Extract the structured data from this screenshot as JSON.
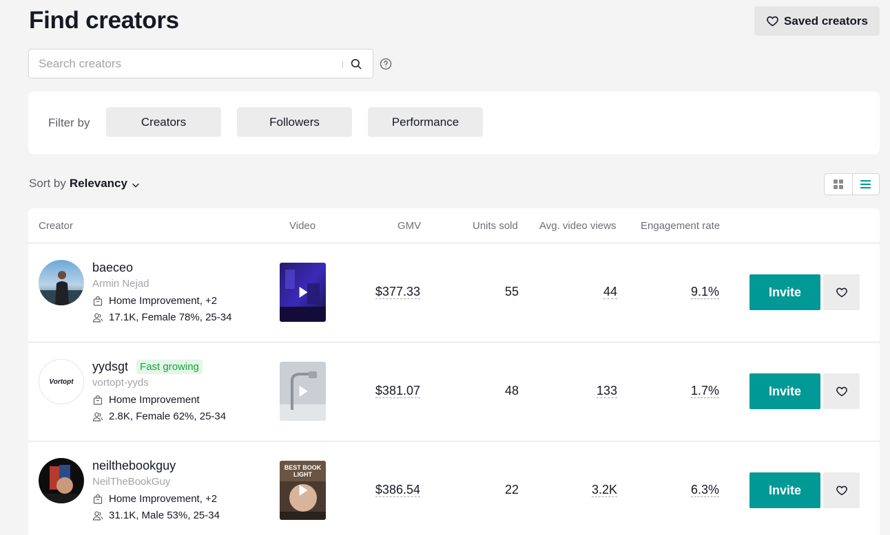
{
  "page": {
    "title": "Find creators"
  },
  "header": {
    "saved_label": "Saved creators"
  },
  "search": {
    "placeholder": "Search creators"
  },
  "filters": {
    "label": "Filter by",
    "buttons": [
      "Creators",
      "Followers",
      "Performance"
    ]
  },
  "sort": {
    "label": "Sort by",
    "value": "Relevancy"
  },
  "table": {
    "columns": [
      "Creator",
      "Video",
      "GMV",
      "Units sold",
      "Avg. video views",
      "Engagement rate"
    ],
    "rows": [
      {
        "handle": "baeceo",
        "name": "Armin Nejad",
        "badge": "",
        "category": "Home Improvement, +2",
        "audience": "17.1K, Female 78%, 25-34",
        "gmv": "$377.33",
        "units": "55",
        "views": "44",
        "engagement": "9.1%",
        "invite": "Invite"
      },
      {
        "handle": "yydsgt",
        "name": "vortopt-yyds",
        "badge": "Fast growing",
        "avatar_text": "Vortopt",
        "category": "Home Improvement",
        "audience": "2.8K, Female 62%, 25-34",
        "gmv": "$381.07",
        "units": "48",
        "views": "133",
        "engagement": "1.7%",
        "invite": "Invite"
      },
      {
        "handle": "neilthebookguy",
        "name": "NeilTheBookGuy",
        "badge": "",
        "thumb_text": "BEST BOOK LIGHT",
        "category": "Home Improvement, +2",
        "audience": "31.1K, Male 53%, 25-34",
        "gmv": "$386.54",
        "units": "22",
        "views": "3.2K",
        "engagement": "6.3%",
        "invite": "Invite"
      }
    ]
  },
  "colors": {
    "accent": "#009995",
    "badge_bg": "#e3f6e7",
    "badge_text": "#15a33f"
  }
}
